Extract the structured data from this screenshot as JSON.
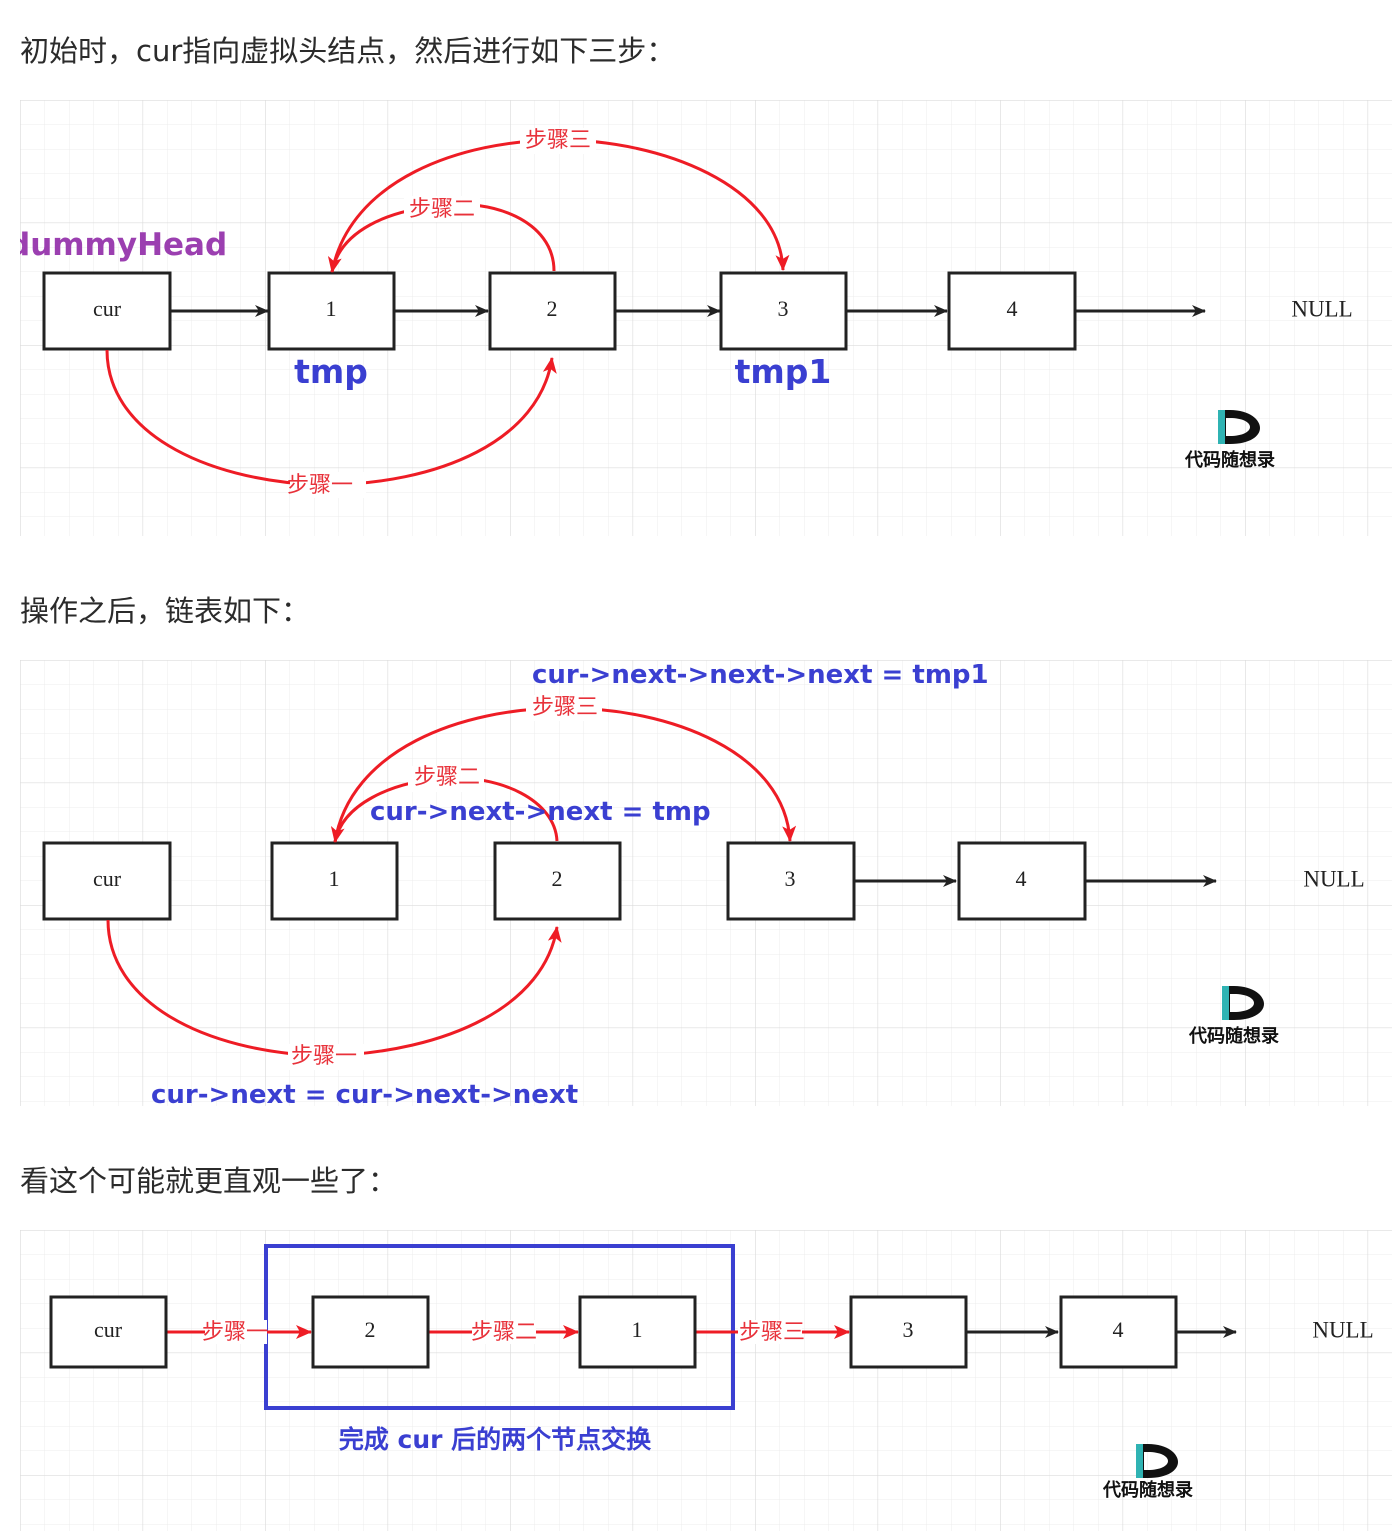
{
  "paragraphs": {
    "intro": "初始时，cur指向虚拟头结点，然后进行如下三步：",
    "after": "操作之后，链表如下：",
    "intuitive": "看这个可能就更直观一些了："
  },
  "colors": {
    "step_arrow": "#ee1c25",
    "blue_label": "#3a3fd1",
    "purple_label": "#9b3fb0",
    "node_border": "#222222",
    "grid": "#e6e6e6",
    "box_highlight": "#3a3fd1"
  },
  "diagram1": {
    "dummy_label": "dummyHead",
    "nodes": [
      "cur",
      "1",
      "2",
      "3",
      "4"
    ],
    "null_label": "NULL",
    "tmp_label": "tmp",
    "tmp1_label": "tmp1",
    "step1": "步骤一",
    "step2": "步骤二",
    "step3": "步骤三"
  },
  "diagram2": {
    "nodes": [
      "cur",
      "1",
      "2",
      "3",
      "4"
    ],
    "null_label": "NULL",
    "step1": "步骤一",
    "step2": "步骤二",
    "step3": "步骤三",
    "code_step1": "cur->next = cur->next->next",
    "code_step2": "cur->next->next = tmp",
    "code_step3": "cur->next->next->next = tmp1"
  },
  "diagram3": {
    "nodes": [
      "cur",
      "2",
      "1",
      "3",
      "4"
    ],
    "null_label": "NULL",
    "step1": "步骤一",
    "step2": "步骤二",
    "step3": "步骤三",
    "box_caption": "完成 cur 后的两个节点交换"
  },
  "logo": {
    "mark": "D",
    "text": "代码随想录",
    "icon": "code-random-thoughts-logo"
  }
}
